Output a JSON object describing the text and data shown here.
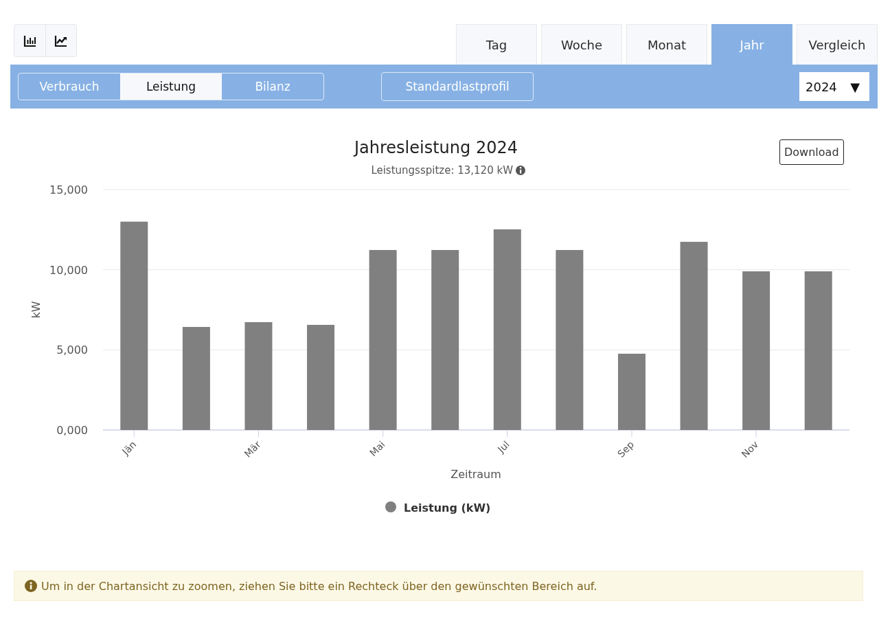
{
  "chart_types": [
    {
      "kind": "bar"
    },
    {
      "kind": "line"
    }
  ],
  "period_tabs": [
    {
      "label": "Tag",
      "selected": false
    },
    {
      "label": "Woche",
      "selected": false
    },
    {
      "label": "Monat",
      "selected": false
    },
    {
      "label": "Jahr",
      "selected": true
    },
    {
      "label": "Vergleich",
      "selected": false
    }
  ],
  "view_segments": [
    {
      "label": "Verbrauch",
      "selected": false
    },
    {
      "label": "Leistung",
      "selected": true
    },
    {
      "label": "Bilanz",
      "selected": false
    }
  ],
  "profile_button": "Standardlastprofil",
  "year_select": {
    "value": "2024",
    "arrow": "▼"
  },
  "chart": {
    "download_button": "Download",
    "peak_note": "Leistungsspitze: 13,120 kW",
    "chart_data": {
      "type": "bar",
      "title": "Jahresleistung 2024",
      "xlabel": "Zeitraum",
      "ylabel": "kW",
      "categories": [
        "Jän",
        null,
        "Mär",
        null,
        "Mai",
        null,
        "Jul",
        null,
        "Sep",
        null,
        "Nov",
        null
      ],
      "series": [
        {
          "name": "Leistung (kW)",
          "color": "#808080",
          "values": [
            13000,
            6430,
            6730,
            6560,
            11230,
            11230,
            12520,
            11230,
            4760,
            11740,
            9900,
            9900
          ]
        }
      ],
      "ylim": [
        0,
        15000
      ],
      "yticks": [
        {
          "value": 0,
          "label": "0,000"
        },
        {
          "value": 5000,
          "label": "5,000"
        },
        {
          "value": 10000,
          "label": "10,000"
        },
        {
          "value": 15000,
          "label": "15,000"
        }
      ]
    }
  },
  "notice": "Um in der Chartansicht zu zoomen, ziehen Sie bitte ein Rechteck über den gewünschten Bereich auf."
}
